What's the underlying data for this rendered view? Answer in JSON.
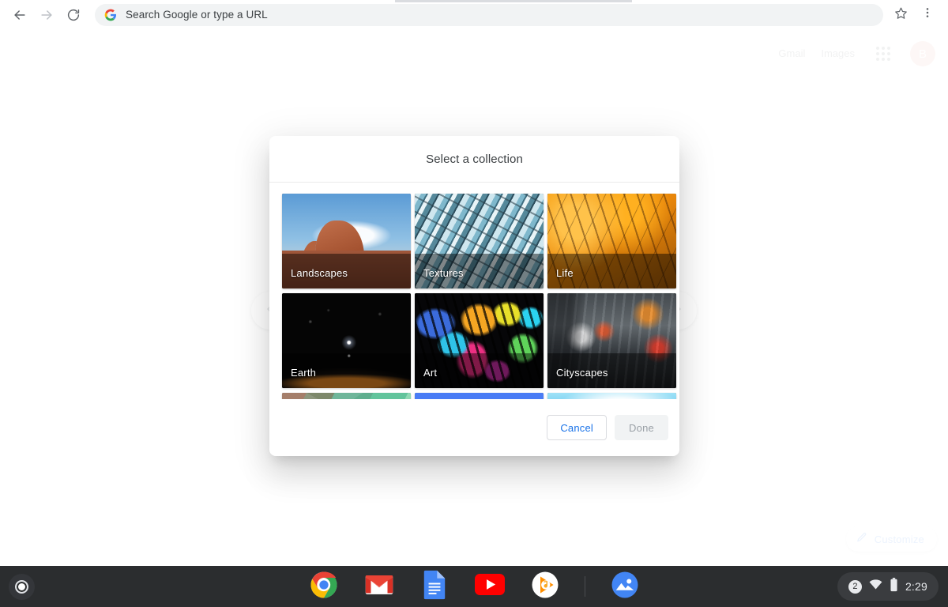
{
  "browser": {
    "back_icon": "back-arrow-icon",
    "forward_icon": "forward-arrow-icon",
    "reload_icon": "reload-icon",
    "omnibox_placeholder": "Search Google or type a URL",
    "omnibox_value": "",
    "bookmark_icon": "star-icon",
    "menu_icon": "three-dot-menu-icon"
  },
  "ntp": {
    "links": [
      {
        "label": "Gmail"
      },
      {
        "label": "Images"
      }
    ],
    "apps_icon": "apps-grid-icon",
    "avatar_letter": "B",
    "prev_icon": "chevron-left-icon",
    "next_icon": "chevron-right-icon",
    "customize": {
      "label": "Customize",
      "icon": "pencil-icon"
    }
  },
  "dialog": {
    "title": "Select a collection",
    "collections": [
      {
        "name": "Landscapes",
        "art": "art-landscapes",
        "labelled": true
      },
      {
        "name": "Textures",
        "art": "art-textures",
        "labelled": true
      },
      {
        "name": "Life",
        "art": "art-life",
        "labelled": true
      },
      {
        "name": "Earth",
        "art": "art-earth",
        "labelled": true
      },
      {
        "name": "Art",
        "art": "art-art",
        "labelled": true
      },
      {
        "name": "Cityscapes",
        "art": "art-cityscapes",
        "labelled": true
      },
      {
        "name": "",
        "art": "art-geometric",
        "labelled": false
      },
      {
        "name": "",
        "art": "art-solid-blue",
        "labelled": false
      },
      {
        "name": "",
        "art": "art-seascape",
        "labelled": false
      }
    ],
    "cancel_label": "Cancel",
    "done_label": "Done"
  },
  "shelf": {
    "launcher_icon": "launcher-icon",
    "apps": [
      {
        "name": "chrome"
      },
      {
        "name": "gmail"
      },
      {
        "name": "docs"
      },
      {
        "name": "youtube"
      },
      {
        "name": "play-music"
      },
      {
        "name": "gallery"
      }
    ],
    "tray": {
      "badge": "2",
      "wifi_icon": "wifi-icon",
      "battery_icon": "battery-icon",
      "time": "2:29"
    }
  },
  "colors": {
    "accent_blue": "#1a73e8",
    "shelf_bg": "#2b2d2f",
    "avatar_bg": "#e8a396",
    "omnibox_bg": "#f1f3f4"
  }
}
